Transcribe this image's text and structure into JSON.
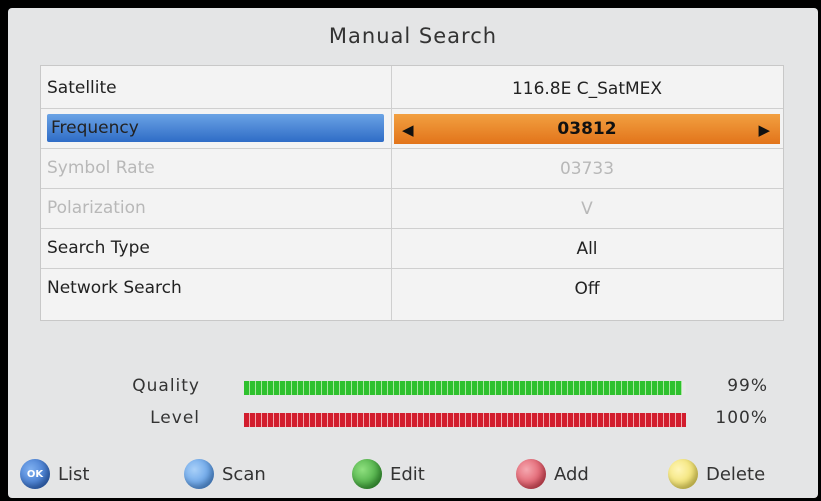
{
  "title": "Manual Search",
  "rows": [
    {
      "label": "Satellite",
      "value": "116.8E C_SatMEX"
    },
    {
      "label": "Frequency",
      "value": "03812"
    },
    {
      "label": "Symbol Rate",
      "value": "03733"
    },
    {
      "label": "Polarization",
      "value": "V"
    },
    {
      "label": "Search Type",
      "value": "All"
    },
    {
      "label": "Network Search",
      "value": "Off"
    }
  ],
  "arrows": {
    "left": "◀",
    "right": "▶"
  },
  "meters": {
    "quality": {
      "label": "Quality",
      "percent_text": "99%",
      "value": 0.99,
      "color": "#2ec12e"
    },
    "level": {
      "label": "Level",
      "percent_text": "100%",
      "value": 1.0,
      "color": "#d21d2e"
    }
  },
  "footer": {
    "ok_badge": "OK",
    "buttons": [
      {
        "label": "List",
        "color": "#2b6fcf",
        "icon": "ok-circle-icon"
      },
      {
        "label": "Scan",
        "color": "#3f8fe0",
        "icon": "blue-circle-icon"
      },
      {
        "label": "Edit",
        "color": "#2a9b2a",
        "icon": "green-circle-icon"
      },
      {
        "label": "Add",
        "color": "#d93a4a",
        "icon": "red-circle-icon"
      },
      {
        "label": "Delete",
        "color": "#f0e05a",
        "icon": "yellow-circle-icon"
      }
    ]
  },
  "colors": {
    "selected_label": "#3f7fd8",
    "selected_value": "#e8852a"
  }
}
